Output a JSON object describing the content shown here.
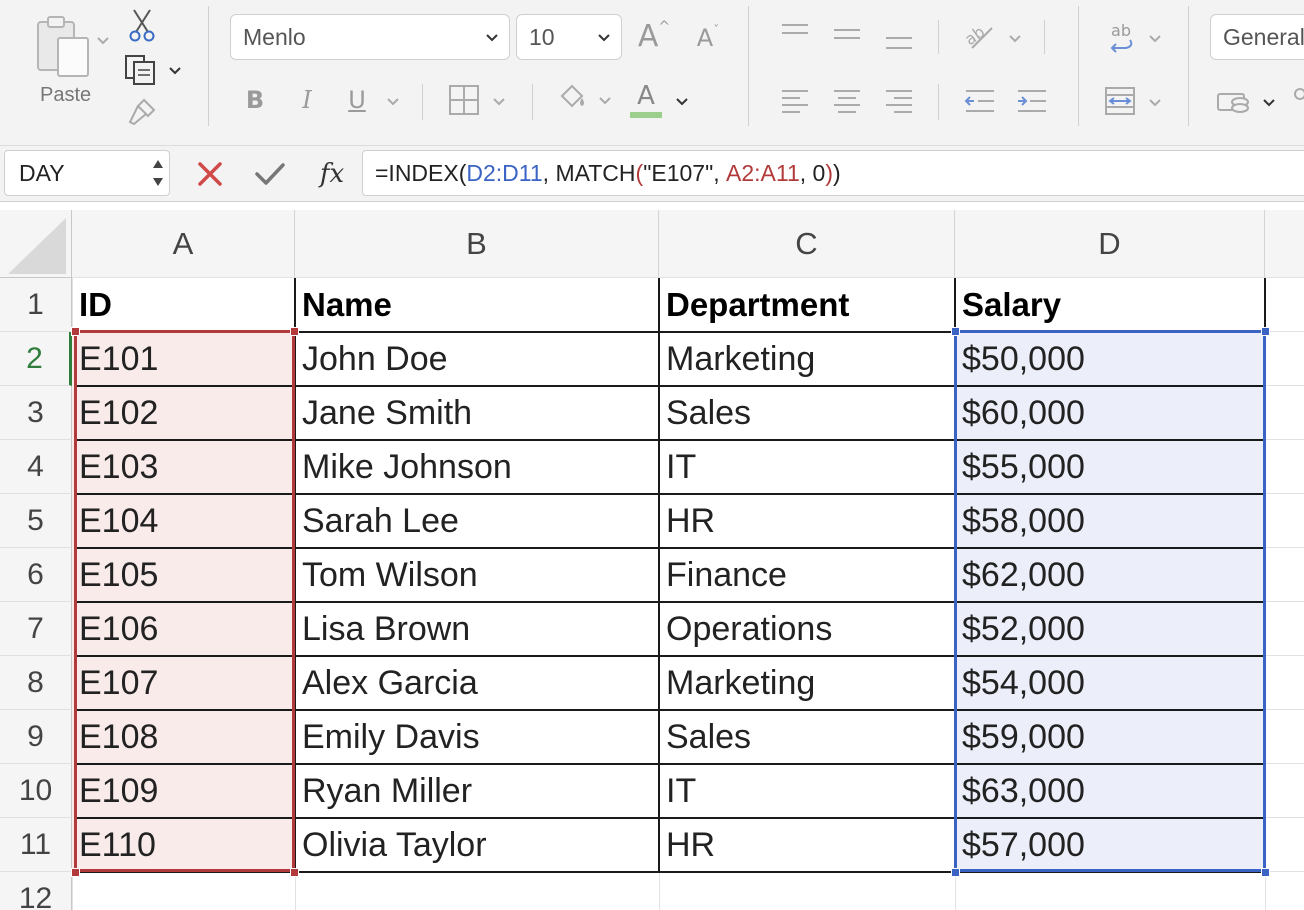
{
  "ribbon": {
    "paste_label": "Paste",
    "font_name": "Menlo",
    "font_size": "10",
    "grow_font_glyph": "A",
    "shrink_font_glyph": "A",
    "bold_glyph": "B",
    "italic_glyph": "I",
    "underline_glyph": "U",
    "font_color_glyph": "A",
    "number_format": "General",
    "wrap_glyph": "ab",
    "accent_font_color": "#9ccf8e"
  },
  "formula_bar": {
    "name_box": "DAY",
    "fx_label": "fx",
    "formula_parts": [
      {
        "text": "=INDEX(",
        "color": "#222222"
      },
      {
        "text": "D2:D11",
        "color": "#3a63c4"
      },
      {
        "text": ", MATCH",
        "color": "#222222"
      },
      {
        "text": "(",
        "color": "#b23a3a"
      },
      {
        "text": "\"E107\", ",
        "color": "#222222"
      },
      {
        "text": "A2:A11",
        "color": "#b23a3a"
      },
      {
        "text": ", 0",
        "color": "#222222"
      },
      {
        "text": ")",
        "color": "#b23a3a"
      },
      {
        "text": ")",
        "color": "#222222"
      }
    ]
  },
  "grid": {
    "columns": [
      "A",
      "B",
      "C",
      "D"
    ],
    "rows": [
      "1",
      "2",
      "3",
      "4",
      "5",
      "6",
      "7",
      "8",
      "9",
      "10",
      "11",
      "12"
    ],
    "header": [
      "ID",
      "Name",
      "Department",
      "Salary"
    ],
    "data": [
      [
        "E101",
        "John Doe",
        "Marketing",
        "$50,000"
      ],
      [
        "E102",
        "Jane Smith",
        "Sales",
        "$60,000"
      ],
      [
        "E103",
        "Mike Johnson",
        "IT",
        "$55,000"
      ],
      [
        "E104",
        "Sarah Lee",
        "HR",
        "$58,000"
      ],
      [
        "E105",
        "Tom Wilson",
        "Finance",
        "$62,000"
      ],
      [
        "E106",
        "Lisa Brown",
        "Operations",
        "$52,000"
      ],
      [
        "E107",
        "Alex Garcia",
        "Marketing",
        "$54,000"
      ],
      [
        "E108",
        "Emily Davis",
        "Sales",
        "$59,000"
      ],
      [
        "E109",
        "Ryan Miller",
        "IT",
        "$63,000"
      ],
      [
        "E110",
        "Olivia Taylor",
        "HR",
        "$57,000"
      ]
    ],
    "range_colors": {
      "lookup_range": "#b23a3a",
      "lookup_fill": "#f8ebea",
      "return_range": "#3a63c4",
      "return_fill": "#eceff9"
    }
  }
}
